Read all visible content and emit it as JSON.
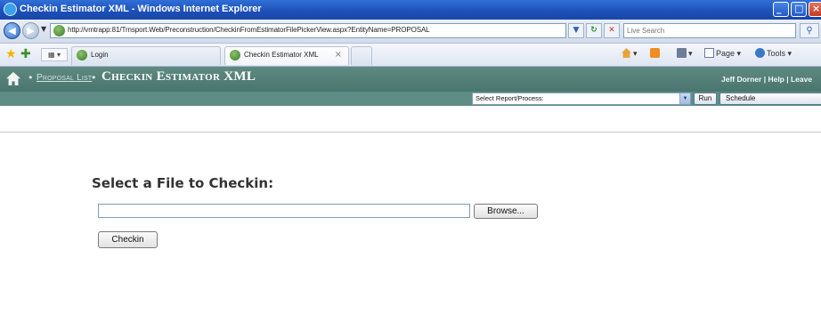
{
  "window": {
    "title": "Checkin Estimator XML - Windows Internet Explorer"
  },
  "address_bar": {
    "url": "http://vmtrapp:81/Trnsport.Web/Preconstruction/CheckinFromEstimatorFilePickerView.aspx?EntityName=PROPOSAL",
    "search_placeholder": "Live Search"
  },
  "tabs": {
    "items": [
      {
        "label": "Login",
        "active": false
      },
      {
        "label": "Checkin Estimator XML",
        "active": true
      }
    ],
    "commands": {
      "page_label": "Page",
      "tools_label": "Tools"
    }
  },
  "app_header": {
    "breadcrumb_link": "Proposal List",
    "separator": "•",
    "page_title": "Checkin Estimator XML",
    "user_name": "Jeff Dorner",
    "help_label": "Help",
    "leave_label": "Leave",
    "link_separator": " | "
  },
  "report_bar": {
    "select_value": "Select Report/Process:",
    "run_label": "Run",
    "schedule_label": "Schedule"
  },
  "content": {
    "heading": "Select a File to Checkin:",
    "file_value": "",
    "browse_label": "Browse...",
    "checkin_label": "Checkin"
  },
  "colors": {
    "titlebar": "#1b4fb8",
    "app_header": "#5a857d",
    "report_bar": "#5f8d86",
    "heading_text": "#333333"
  },
  "icons": {
    "app": "ie-logo-icon",
    "home": "home-icon",
    "favorites": "star-icon",
    "add_favorite": "add-favorite-icon"
  }
}
